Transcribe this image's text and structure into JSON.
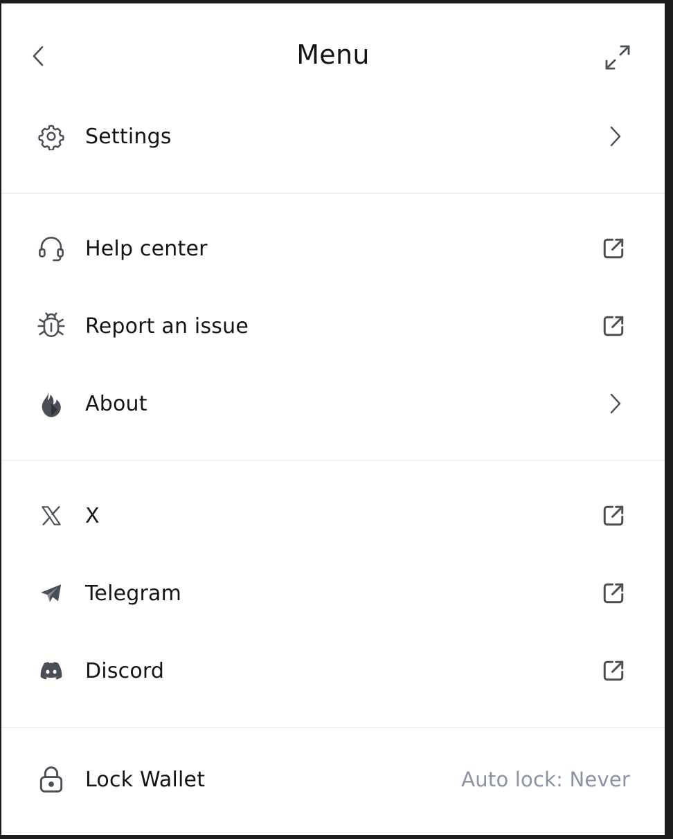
{
  "header": {
    "title": "Menu",
    "back_icon": "chevron-left-icon",
    "expand_icon": "expand-icon"
  },
  "sections": [
    {
      "items": [
        {
          "label": "Settings",
          "icon": "gear-icon",
          "trailing": "chevron-right-icon"
        }
      ]
    },
    {
      "items": [
        {
          "label": "Help center",
          "icon": "headset-icon",
          "trailing": "external-link-icon"
        },
        {
          "label": "Report an issue",
          "icon": "bug-icon",
          "trailing": "external-link-icon"
        },
        {
          "label": "About",
          "icon": "flame-logo-icon",
          "trailing": "chevron-right-icon"
        }
      ]
    },
    {
      "items": [
        {
          "label": "X",
          "icon": "x-logo-icon",
          "trailing": "external-link-icon"
        },
        {
          "label": "Telegram",
          "icon": "telegram-icon",
          "trailing": "external-link-icon"
        },
        {
          "label": "Discord",
          "icon": "discord-icon",
          "trailing": "external-link-icon"
        }
      ]
    }
  ],
  "lock": {
    "label": "Lock Wallet",
    "icon": "lock-icon",
    "auto_lock": "Auto lock: Never"
  },
  "colors": {
    "background": "#ffffff",
    "text": "#141414",
    "icon": "#4a4f57",
    "muted": "#8993a4",
    "divider": "#f0f1f3"
  }
}
